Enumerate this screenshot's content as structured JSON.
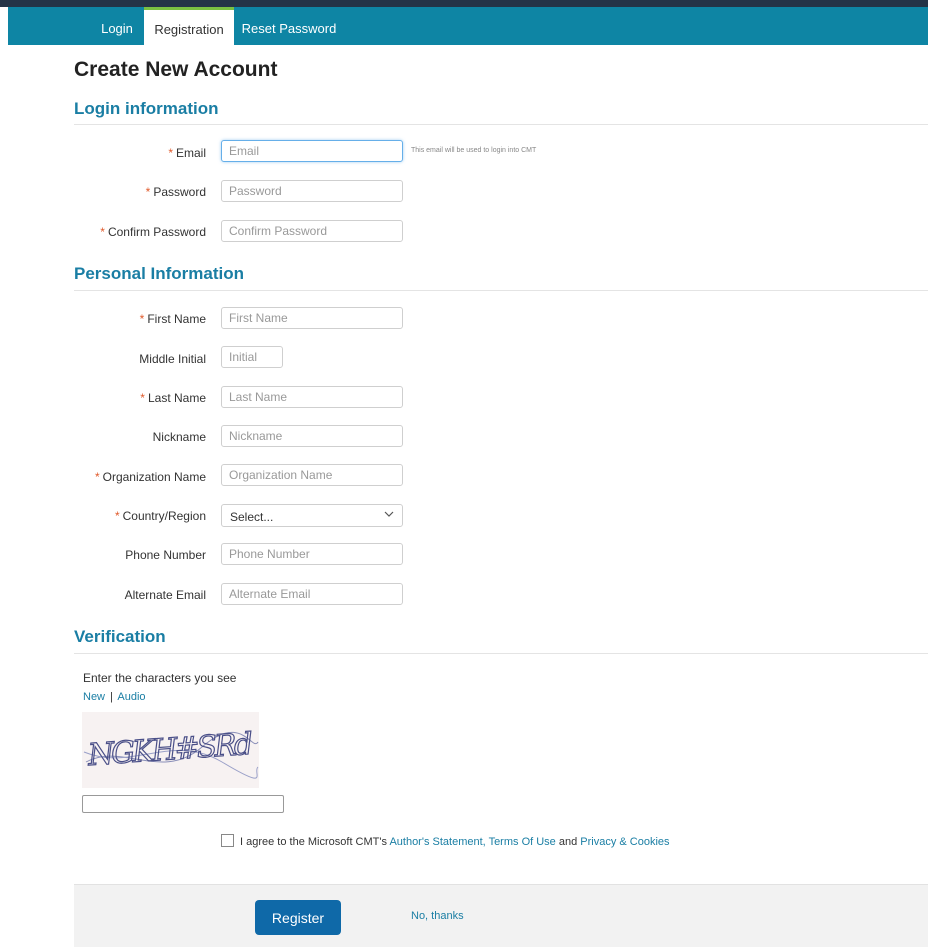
{
  "tabs": [
    {
      "label": "Login"
    },
    {
      "label": "Registration"
    },
    {
      "label": "Reset Password"
    }
  ],
  "page_title": "Create New Account",
  "sections": {
    "login": "Login information",
    "personal": "Personal Information",
    "verification": "Verification"
  },
  "required_mark": "*",
  "fields": {
    "email": {
      "label": "Email",
      "placeholder": "Email",
      "required": true,
      "hint": "This email will be used to login into CMT"
    },
    "password": {
      "label": "Password",
      "placeholder": "Password",
      "required": true
    },
    "confirm_password": {
      "label": "Confirm Password",
      "placeholder": "Confirm Password",
      "required": true
    },
    "first_name": {
      "label": "First Name",
      "placeholder": "First Name",
      "required": true
    },
    "middle_initial": {
      "label": "Middle Initial",
      "placeholder": "Initial",
      "required": false
    },
    "last_name": {
      "label": "Last Name",
      "placeholder": "Last Name",
      "required": true
    },
    "nickname": {
      "label": "Nickname",
      "placeholder": "Nickname",
      "required": false
    },
    "organization": {
      "label": "Organization Name",
      "placeholder": "Organization Name",
      "required": true
    },
    "country": {
      "label": "Country/Region",
      "selected": "Select...",
      "required": true
    },
    "phone": {
      "label": "Phone Number",
      "placeholder": "Phone Number",
      "required": false
    },
    "alt_email": {
      "label": "Alternate Email",
      "placeholder": "Alternate Email",
      "required": false
    }
  },
  "verification": {
    "instruction": "Enter the characters you see",
    "new_link": "New",
    "separator": "|",
    "audio_link": "Audio",
    "captcha_text": "NGKH#SRd"
  },
  "agreement": {
    "prefix": "I agree to the Microsoft CMT's",
    "authors_statement": "Author's Statement,",
    "terms": "Terms Of Use",
    "and": "and",
    "privacy": "Privacy & Cookies"
  },
  "footer": {
    "register": "Register",
    "no_thanks": "No, thanks"
  },
  "colors": {
    "nav_bg": "#0e85a4",
    "section_heading": "#1a7ea4",
    "required": "#e05a2b",
    "button": "#0f69a8",
    "active_tab_accent": "#7ac142"
  },
  "icons": {
    "select_caret": "chevron-down-icon"
  }
}
